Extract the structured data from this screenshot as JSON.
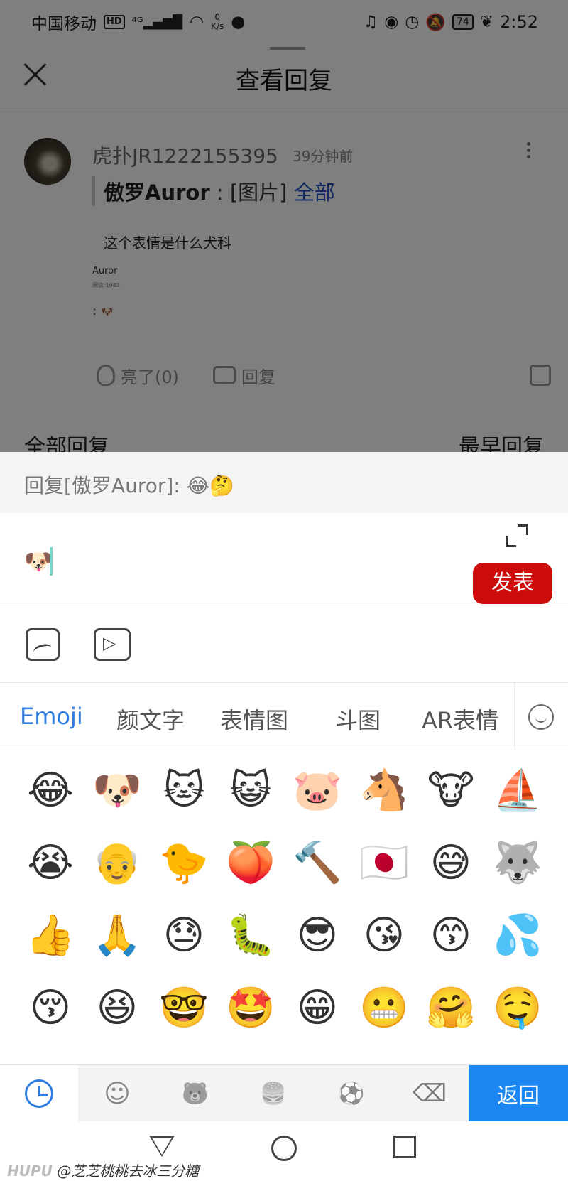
{
  "status_bar": {
    "carrier": "中国移动",
    "hd": "HD",
    "signal": "⁴ᴳ▂▄▆█",
    "wifi": "◠",
    "net_speed_value": "0",
    "net_speed_unit": "K/s",
    "battery": "74",
    "time": "2:52"
  },
  "header": {
    "title": "查看回复"
  },
  "post": {
    "username": "虎扑JR1222155395",
    "time_ago": "39分钟前",
    "quote_author": "傲罗Auror",
    "quote_sep": " : ",
    "quote_image": "[图片] ",
    "quote_link": "全部",
    "reply_text": "这个表情是什么犬科",
    "mini_name": "Auror",
    "mini_stats": "阅读 1983",
    "mini_emoji": "：🐶",
    "like_label": "亮了(0)",
    "reply_label": "回复"
  },
  "section": {
    "title": "全部回复",
    "sort": "最早回复"
  },
  "reply_panel": {
    "header": "回复[傲罗Auror]: 😂🤔",
    "input_value": "🐶",
    "send_label": "发表"
  },
  "tabs": [
    {
      "label": "Emoji"
    },
    {
      "label": "颜文字"
    },
    {
      "label": "表情图"
    },
    {
      "label": "斗图"
    },
    {
      "label": "AR表情"
    }
  ],
  "emoji_grid": [
    "😂",
    "🐶",
    "🐱",
    "😺",
    "🐷",
    "🐴",
    "🐮",
    "⛵",
    "😭",
    "👴",
    "🐤",
    "🍑",
    "🔨",
    "🇯🇵",
    "😅",
    "🐺",
    "👍",
    "🙏",
    "😓",
    "🐛",
    "😎",
    "😘",
    "😙",
    "💦",
    "😚",
    "😆",
    "🤓",
    "🤩",
    "😁",
    "😬",
    "🤗",
    "🤤"
  ],
  "emoji_categories": {
    "smileys": "☺",
    "animals": "🐻",
    "food": "🍔",
    "sports": "⚽",
    "backspace": "⌫",
    "back_label": "返回"
  },
  "watermark": {
    "brand": "HUPU",
    "author": "@芝芝桃桃去冰三分糖"
  }
}
